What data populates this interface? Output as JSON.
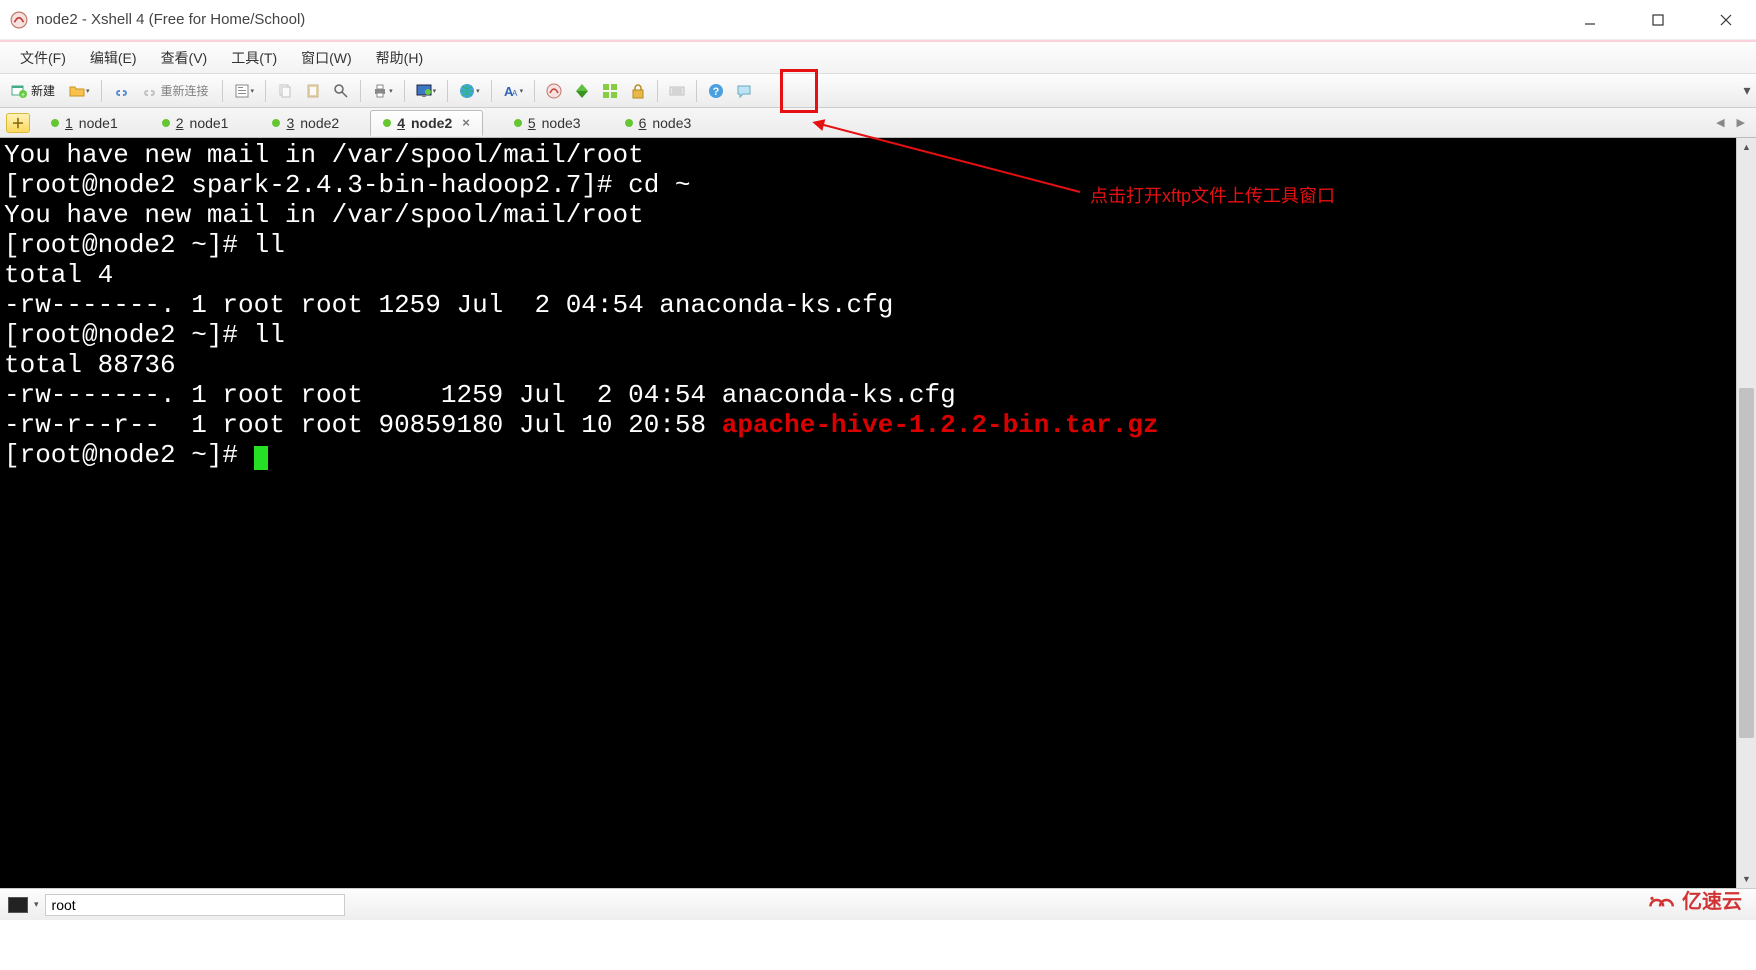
{
  "window": {
    "title": "node2 - Xshell 4 (Free for Home/School)"
  },
  "menu": {
    "file": "文件(F)",
    "edit": "编辑(E)",
    "view": "查看(V)",
    "tools": "工具(T)",
    "window": "窗口(W)",
    "help": "帮助(H)"
  },
  "toolbar": {
    "new_label": "新建",
    "reconnect_label": "重新连接"
  },
  "tabs": [
    {
      "index": "1",
      "label": "node1",
      "active": false
    },
    {
      "index": "2",
      "label": "node1",
      "active": false
    },
    {
      "index": "3",
      "label": "node2",
      "active": false
    },
    {
      "index": "4",
      "label": "node2",
      "active": true
    },
    {
      "index": "5",
      "label": "node3",
      "active": false
    },
    {
      "index": "6",
      "label": "node3",
      "active": false
    }
  ],
  "terminal": {
    "lines": [
      {
        "t": "You have new mail in /var/spool/mail/root"
      },
      {
        "t": "[root@node2 spark-2.4.3-bin-hadoop2.7]# cd ~"
      },
      {
        "t": "You have new mail in /var/spool/mail/root"
      },
      {
        "t": "[root@node2 ~]# ll"
      },
      {
        "t": "total 4"
      },
      {
        "t": "-rw-------. 1 root root 1259 Jul  2 04:54 anaconda-ks.cfg"
      },
      {
        "t": "[root@node2 ~]# ll"
      },
      {
        "t": "total 88736"
      },
      {
        "t": "-rw-------. 1 root root     1259 Jul  2 04:54 anaconda-ks.cfg"
      },
      {
        "t": "-rw-r--r--  1 root root 90859180 Jul 10 20:58 ",
        "r": "apache-hive-1.2.2-bin.tar.gz"
      },
      {
        "t": "[root@node2 ~]# ",
        "cursor": true
      }
    ]
  },
  "annotation": {
    "text": "点击打开xftp文件上传工具窗口"
  },
  "addressbar": {
    "value": "root"
  },
  "watermark": "亿速云"
}
